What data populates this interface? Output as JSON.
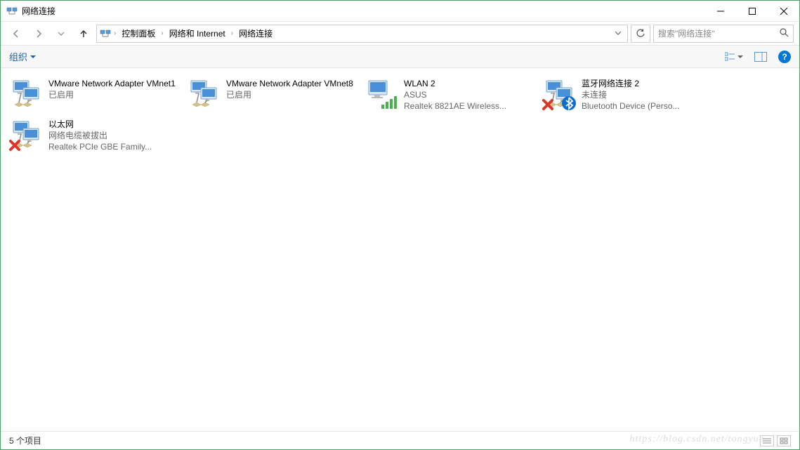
{
  "window": {
    "title": "网络连接"
  },
  "breadcrumb": {
    "items": [
      "控制面板",
      "网络和 Internet",
      "网络连接"
    ]
  },
  "search": {
    "placeholder": "搜索\"网络连接\""
  },
  "toolbar": {
    "organize": "组织"
  },
  "connections": [
    {
      "name": "VMware Network Adapter VMnet1",
      "status": "已启用",
      "device": "",
      "icon": "net",
      "error": false,
      "overlay": null
    },
    {
      "name": "VMware Network Adapter VMnet8",
      "status": "已启用",
      "device": "",
      "icon": "net",
      "error": false,
      "overlay": null
    },
    {
      "name": "WLAN 2",
      "status": "ASUS",
      "device": "Realtek 8821AE Wireless...",
      "icon": "wlan",
      "error": false,
      "overlay": null
    },
    {
      "name": "蓝牙网络连接 2",
      "status": "未连接",
      "device": "Bluetooth Device (Perso...",
      "icon": "net",
      "error": true,
      "overlay": "bt"
    },
    {
      "name": "以太网",
      "status": "网络电缆被拔出",
      "device": "Realtek PCIe GBE Family...",
      "icon": "net",
      "error": true,
      "overlay": null
    }
  ],
  "statusbar": {
    "count": "5 个项目"
  },
  "watermark": "https://blog.csdn.net/tongyue"
}
